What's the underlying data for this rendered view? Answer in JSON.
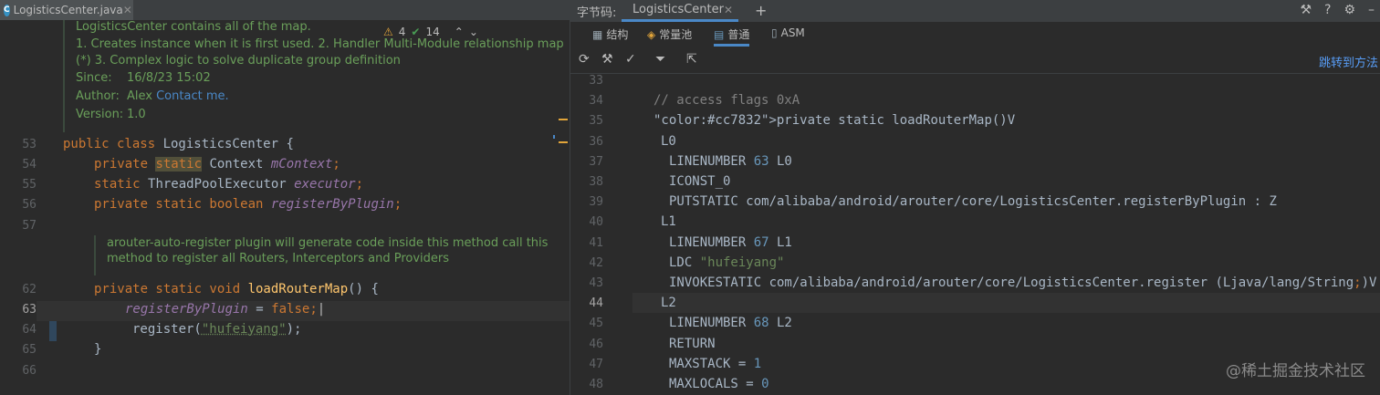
{
  "editor": {
    "tab": {
      "filename": "LogisticsCenter.java",
      "icon_letter": "C"
    },
    "inspections": {
      "warnings": "4",
      "ok": "14"
    },
    "doc": {
      "summary": "LogisticsCenter contains all of the map.",
      "details_1": "1. Creates instance when it is first used. 2. Handler Multi-Module relationship map",
      "details_2": "(*) 3. Complex logic to solve duplicate group definition",
      "since_label": "Since:",
      "since_value": "16/8/23 15:02",
      "author_label": "Author:",
      "author_value": "Alex",
      "author_link": "Contact me.",
      "version_label": "Version:",
      "version_value": "1.0"
    },
    "doc2": {
      "line_1": "arouter-auto-register plugin will generate code inside this method call this",
      "line_2": "method to register all Routers, Interceptors and Providers"
    },
    "line_numbers": [
      "53",
      "54",
      "55",
      "56",
      "57",
      "62",
      "63",
      "64",
      "65",
      "66"
    ],
    "code": {
      "l53_kw": "public class ",
      "l53_rest": "LogisticsCenter {",
      "l54_kw1": "private ",
      "l54_static": "static",
      "l54_type": " Context ",
      "l54_field": "mContext",
      "l54_end": ";",
      "l55_kw": "static ",
      "l55_type": "ThreadPoolExecutor ",
      "l55_field": "executor",
      "l55_end": ";",
      "l56_kw": "private static boolean ",
      "l56_field": "registerByPlugin",
      "l56_end": ";",
      "l62_kw": "private static void ",
      "l62_fn": "loadRouterMap",
      "l62_end": "() {",
      "l63_field": "registerByPlugin",
      "l63_op": " = ",
      "l63_val": "false",
      "l63_end": ";",
      "l64_call": "register(",
      "l64_str": "\"hufeiyang\"",
      "l64_end": ");",
      "l65": "}"
    }
  },
  "bytecode": {
    "label": "字节码:",
    "tab_title": "LogisticsCenter",
    "tabs": [
      "结构",
      "常量池",
      "普通",
      "ASM"
    ],
    "jump_label": "跳转到方法",
    "lines": [
      {
        "n": "33",
        "t": ""
      },
      {
        "n": "34",
        "t": "// access flags 0xA"
      },
      {
        "n": "35",
        "t": "private static loadRouterMap()V"
      },
      {
        "n": "36",
        "t": "L0"
      },
      {
        "n": "37",
        "t": "LINENUMBER 63 L0"
      },
      {
        "n": "38",
        "t": "ICONST_0"
      },
      {
        "n": "39",
        "t": "PUTSTATIC com/alibaba/android/arouter/core/LogisticsCenter.registerByPlugin : Z"
      },
      {
        "n": "40",
        "t": "L1"
      },
      {
        "n": "41",
        "t": "LINENUMBER 67 L1"
      },
      {
        "n": "42",
        "t": "LDC \"hufeiyang\""
      },
      {
        "n": "43",
        "t": "INVOKESTATIC com/alibaba/android/arouter/core/LogisticsCenter.register (Ljava/lang/String;)V"
      },
      {
        "n": "44",
        "t": "L2"
      },
      {
        "n": "45",
        "t": "LINENUMBER 68 L2"
      },
      {
        "n": "46",
        "t": "RETURN"
      },
      {
        "n": "47",
        "t": "MAXSTACK = 1"
      },
      {
        "n": "48",
        "t": "MAXLOCALS = 0"
      }
    ],
    "watermark": "@稀土掘金技术社区"
  },
  "colors": {
    "accent": "#4a88c7",
    "keyword": "#cc7832",
    "string": "#6a8759",
    "comment": "#808080",
    "number": "#6897bb"
  }
}
